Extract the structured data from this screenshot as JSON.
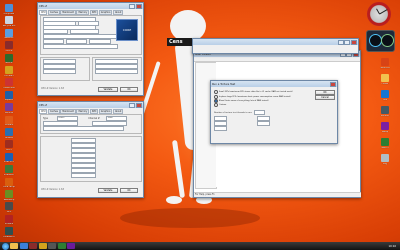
{
  "wallpaper": {
    "text": "Cens"
  },
  "desktop_icons_left": [
    {
      "label": "Computer",
      "color": "#4f8fd8"
    },
    {
      "label": "Recycle Bin",
      "color": "#c9d6e4"
    },
    {
      "label": "Network",
      "color": "#5a9ee0"
    },
    {
      "label": "CPU-Z",
      "color": "#8a2b2b"
    },
    {
      "label": "GPU-Z",
      "color": "#2d6a2d"
    },
    {
      "label": "Prime95",
      "color": "#d4a21e"
    },
    {
      "label": "HWMonitor",
      "color": "#c33"
    },
    {
      "label": "SuperPi",
      "color": "#1f5fa8"
    },
    {
      "label": "wPrime",
      "color": "#7a3b9a"
    },
    {
      "label": "3DMark",
      "color": "#e05c1a"
    },
    {
      "label": "Aida64",
      "color": "#2a6fb0"
    },
    {
      "label": "OCCT",
      "color": "#9e2d1f"
    },
    {
      "label": "Intel XTU",
      "color": "#1a5fb4"
    },
    {
      "label": "IntelBurn",
      "color": "#3c7a3c"
    },
    {
      "label": "Core Temp",
      "color": "#d95f0e"
    },
    {
      "label": "RealTemp",
      "color": "#6b8e23"
    },
    {
      "label": "Linx",
      "color": "#4a4a4a"
    },
    {
      "label": "PCMark",
      "color": "#b22222"
    },
    {
      "label": "Cinebench",
      "color": "#2f4f4f"
    }
  ],
  "desktop_icons_right": [
    {
      "label": "Clock",
      "color": "#c62828"
    },
    {
      "label": "CPU Meter",
      "color": "#1e2a3a"
    },
    {
      "label": "Shortcut",
      "color": "#d84315"
    },
    {
      "label": "Folder",
      "color": "#f2c14e"
    },
    {
      "label": "Tool",
      "color": "#1976d2"
    },
    {
      "label": "Monitor",
      "color": "#455a64"
    },
    {
      "label": "Setup",
      "color": "#7b1fa2"
    },
    {
      "label": "Bench",
      "color": "#2e7d32"
    },
    {
      "label": "Log",
      "color": "#b0bec5"
    }
  ],
  "cpuz_top": {
    "title": "CPU-Z",
    "tabs": [
      "CPU",
      "Caches",
      "Mainboard",
      "Memory",
      "SPD",
      "Graphics",
      "About"
    ],
    "badge": "CORE",
    "version_label": "CPU-Z Version 1.63",
    "validate_btn": "Validate",
    "ok_btn": "OK"
  },
  "cpuz_bottom": {
    "title": "CPU-Z",
    "tabs": [
      "CPU",
      "Caches",
      "Mainboard",
      "Memory",
      "SPD",
      "Graphics",
      "About"
    ],
    "type_label": "Type",
    "type_value": "DDR3",
    "channels_label": "Channel #",
    "channels_value": "Dual",
    "version_label": "CPU-Z Version 1.63",
    "validate_btn": "Validate",
    "ok_btn": "OK"
  },
  "dialog": {
    "title": "Run a Torture Test",
    "options": [
      "Small FFTs (maximum FPU stress, data fits in L2 cache, RAM not tested much)",
      "In-place large FFTs (maximum heat, power consumption, some RAM tested)",
      "Blend (tests some of everything, lots of RAM tested)",
      "Custom"
    ],
    "threads_label": "Number of torture test threads to run:",
    "ok_btn": "OK",
    "cancel_btn": "Cancel"
  },
  "prime_window": {
    "title": "Main thread",
    "status": "For Help, press F1"
  },
  "clock": {
    "time": "10:10"
  }
}
